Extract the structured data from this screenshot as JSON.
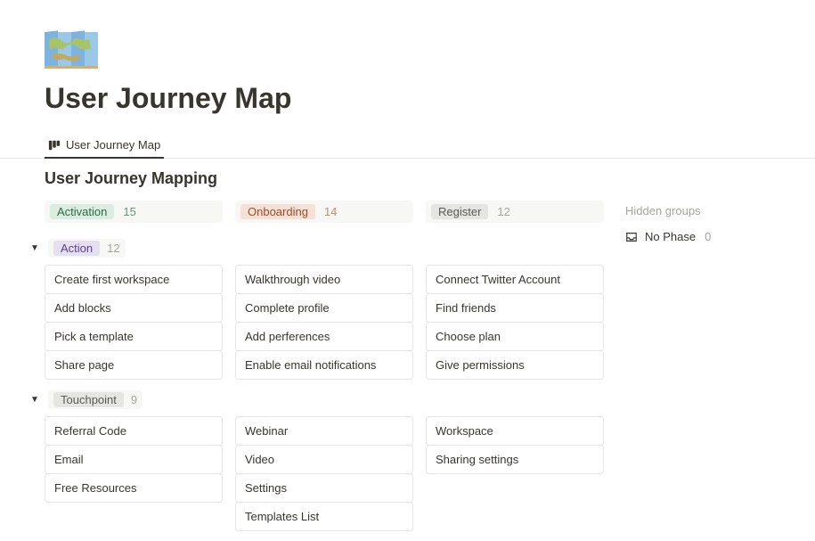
{
  "icon_alt": "world-map",
  "page_title": "User Journey Map",
  "tab": {
    "label": "User Journey Map"
  },
  "section_title": "User Journey Mapping",
  "columns": [
    {
      "label": "Activation",
      "count": "15",
      "pill": "green",
      "count_class": "count-green"
    },
    {
      "label": "Onboarding",
      "count": "14",
      "pill": "orange",
      "count_class": "count-orange"
    },
    {
      "label": "Register",
      "count": "12",
      "pill": "gray",
      "count_class": ""
    }
  ],
  "groups": [
    {
      "label": "Action",
      "count": "12",
      "pill": "purple",
      "cards": [
        [
          "Create first workspace",
          "Add blocks",
          "Pick a template",
          "Share page"
        ],
        [
          "Walkthrough video",
          "Complete profile",
          "Add perferences",
          "Enable email notifications"
        ],
        [
          "Connect Twitter Account",
          "Find friends",
          "Choose plan",
          "Give permissions"
        ]
      ]
    },
    {
      "label": "Touchpoint",
      "count": "9",
      "pill": "gray",
      "cards": [
        [
          "Referral Code",
          "Email",
          "Free Resources"
        ],
        [
          "Webinar",
          "Video",
          "Settings",
          "Templates List"
        ],
        [
          "Workspace",
          "Sharing settings"
        ]
      ]
    }
  ],
  "hidden": {
    "title": "Hidden groups",
    "items": [
      {
        "label": "No Phase",
        "count": "0"
      }
    ]
  }
}
